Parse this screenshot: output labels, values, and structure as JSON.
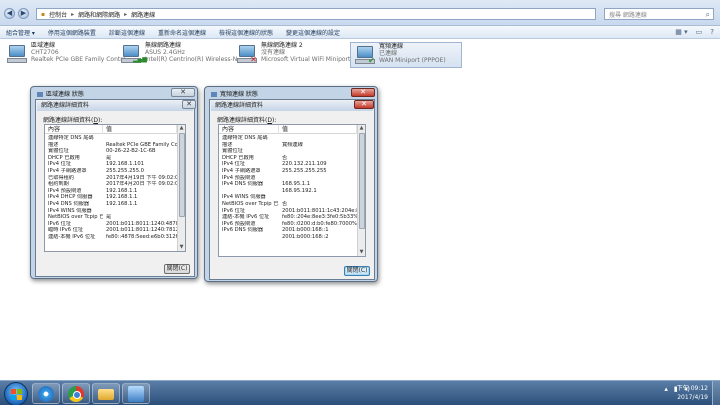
{
  "explorer": {
    "breadcrumbs": [
      "控制台",
      "網路和網際網路",
      "網路連線"
    ],
    "search_placeholder": "搜尋 網路連線",
    "toolbar": [
      "組合管理 ▾",
      "停用這個網路裝置",
      "診斷這個連線",
      "重新命名這個連線",
      "檢視這個連線的狀態",
      "變更這個連線的設定"
    ],
    "adapters": [
      {
        "name": "區域連線",
        "status": "CHT2706",
        "device": "Realtek PCIe GBE Family Contro...",
        "badge": "",
        "selected": false
      },
      {
        "name": "無線網路連線",
        "status": "ASUS 2.4GHz",
        "device": "Intel(R) Centrino(R) Wireless-N...",
        "badge": "bars",
        "selected": false
      },
      {
        "name": "無線網路連線 2",
        "status": "沒有連線",
        "device": "Microsoft Virtual WiFi Miniport ...",
        "badge": "x",
        "selected": false
      },
      {
        "name": "寬頻連線",
        "status": "已連線",
        "device": "WAN Miniport (PPPOE)",
        "badge": "check",
        "selected": true
      }
    ]
  },
  "dialog_local": {
    "title": "區域連線 狀態",
    "details_title": "網路連線詳細資料",
    "caption": "網路連線詳細資料(",
    "caption_key": "D",
    "caption_end": "):",
    "col_property": "內容",
    "col_value": "值",
    "rows": [
      [
        "連線特定 DNS 尾碼",
        ""
      ],
      [
        "描述",
        "Realtek PCIe GBE Family Controller"
      ],
      [
        "實體位址",
        "00-26-22-B2-1C-6B"
      ],
      [
        "DHCP 已啟用",
        "是"
      ],
      [
        "IPv4 位址",
        "192.168.1.101"
      ],
      [
        "IPv4 子網路遮罩",
        "255.255.255.0"
      ],
      [
        "已取得租約",
        "2017年4月19日 下午 09:02:07"
      ],
      [
        "租約到期",
        "2017年4月20日 下午 09:02:07"
      ],
      [
        "IPv4 預設閘道",
        "192.168.1.1"
      ],
      [
        "IPv4 DHCP 伺服器",
        "192.168.1.1"
      ],
      [
        "IPv4 DNS 伺服器",
        "192.168.1.1"
      ],
      [
        "IPv4 WINS 伺服器",
        ""
      ],
      [
        "NetBIOS over Tcpip 已...",
        "是"
      ],
      [
        "IPv6 位址",
        "2001:b011:8011:1240:4878:5eed:e6b..."
      ],
      [
        "臨時 IPv6 位址",
        "2001:b011:8011:1240:7812:9074:474..."
      ],
      [
        "連結-本機 IPv6 位址",
        "fe80::4878:5eed:e6b0:312f%11"
      ]
    ],
    "close_label": "關閉(C)"
  },
  "dialog_broadband": {
    "title": "寬頻連線 狀態",
    "details_title": "網路連線詳細資料",
    "caption": "網路連線詳細資料(",
    "caption_key": "D",
    "caption_end": "):",
    "col_property": "內容",
    "col_value": "值",
    "rows": [
      [
        "連線特定 DNS 尾碼",
        ""
      ],
      [
        "描述",
        "寬頻連線"
      ],
      [
        "實體位址",
        ""
      ],
      [
        "DHCP 已啟用",
        "否"
      ],
      [
        "IPv4 位址",
        "220.132.211.109"
      ],
      [
        "IPv4 子網路遮罩",
        "255.255.255.255"
      ],
      [
        "IPv4 預設閘道",
        ""
      ],
      [
        "IPv4 DNS 伺服器",
        "168.95.1.1"
      ],
      [
        "",
        "168.95.192.1"
      ],
      [
        "IPv4 WINS 伺服器",
        ""
      ],
      [
        "NetBIOS over Tcpip 已...",
        "否"
      ],
      [
        "IPv6 位址",
        "2001:b011:8011:1c43:204e:8ee3:3fe0:3..."
      ],
      [
        "連結-本機 IPv6 位址",
        "fe80::204e:8ee3:3fe0:5b33%32"
      ],
      [
        "IPv6 預設閘道",
        "fe80::0200:d:b0:fe80:7000%32"
      ],
      [
        "IPv6 DNS 伺服器",
        "2001:b000:168::1"
      ],
      [
        "",
        "2001:b000:168::2"
      ]
    ],
    "close_label": "關閉(C)"
  },
  "taskbar": {
    "time": "下午 09:12",
    "date": "2017/4/19"
  }
}
